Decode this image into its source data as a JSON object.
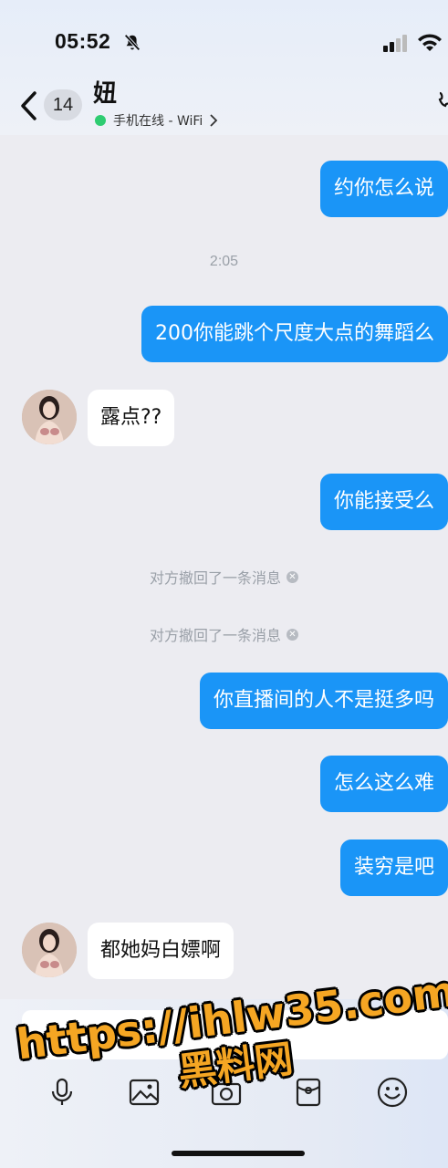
{
  "status_bar": {
    "time": "05:52"
  },
  "header": {
    "back_badge": "14",
    "contact_name": "妞",
    "presence": "手机在线 - WiFi",
    "online_color": "#2ecc71"
  },
  "messages": [
    {
      "side": "out",
      "text": "约你怎么说"
    },
    {
      "type": "time",
      "text": "2:05"
    },
    {
      "side": "out",
      "text": "200你能跳个尺度大点的舞蹈么"
    },
    {
      "side": "in",
      "text": "露点??"
    },
    {
      "side": "out",
      "text": "你能接受么"
    },
    {
      "type": "recall",
      "text": "对方撤回了一条消息"
    },
    {
      "type": "recall",
      "text": "对方撤回了一条消息"
    },
    {
      "side": "out",
      "text": "你直播间的人不是挺多吗"
    },
    {
      "side": "out",
      "text": "怎么这么难"
    },
    {
      "side": "out",
      "text": "装穷是吧"
    },
    {
      "side": "in",
      "text": "都她妈白嫖啊"
    }
  ],
  "toolbar": {
    "icons": [
      "voice-icon",
      "image-icon",
      "camera-icon",
      "redpacket-icon",
      "emoji-icon"
    ]
  },
  "watermark": {
    "line1": "https://ihlw35.com",
    "line2": "黑料网"
  },
  "colors": {
    "outgoing_bubble": "#1a95f7",
    "incoming_bubble": "#ffffff",
    "background": "#ececf1"
  }
}
